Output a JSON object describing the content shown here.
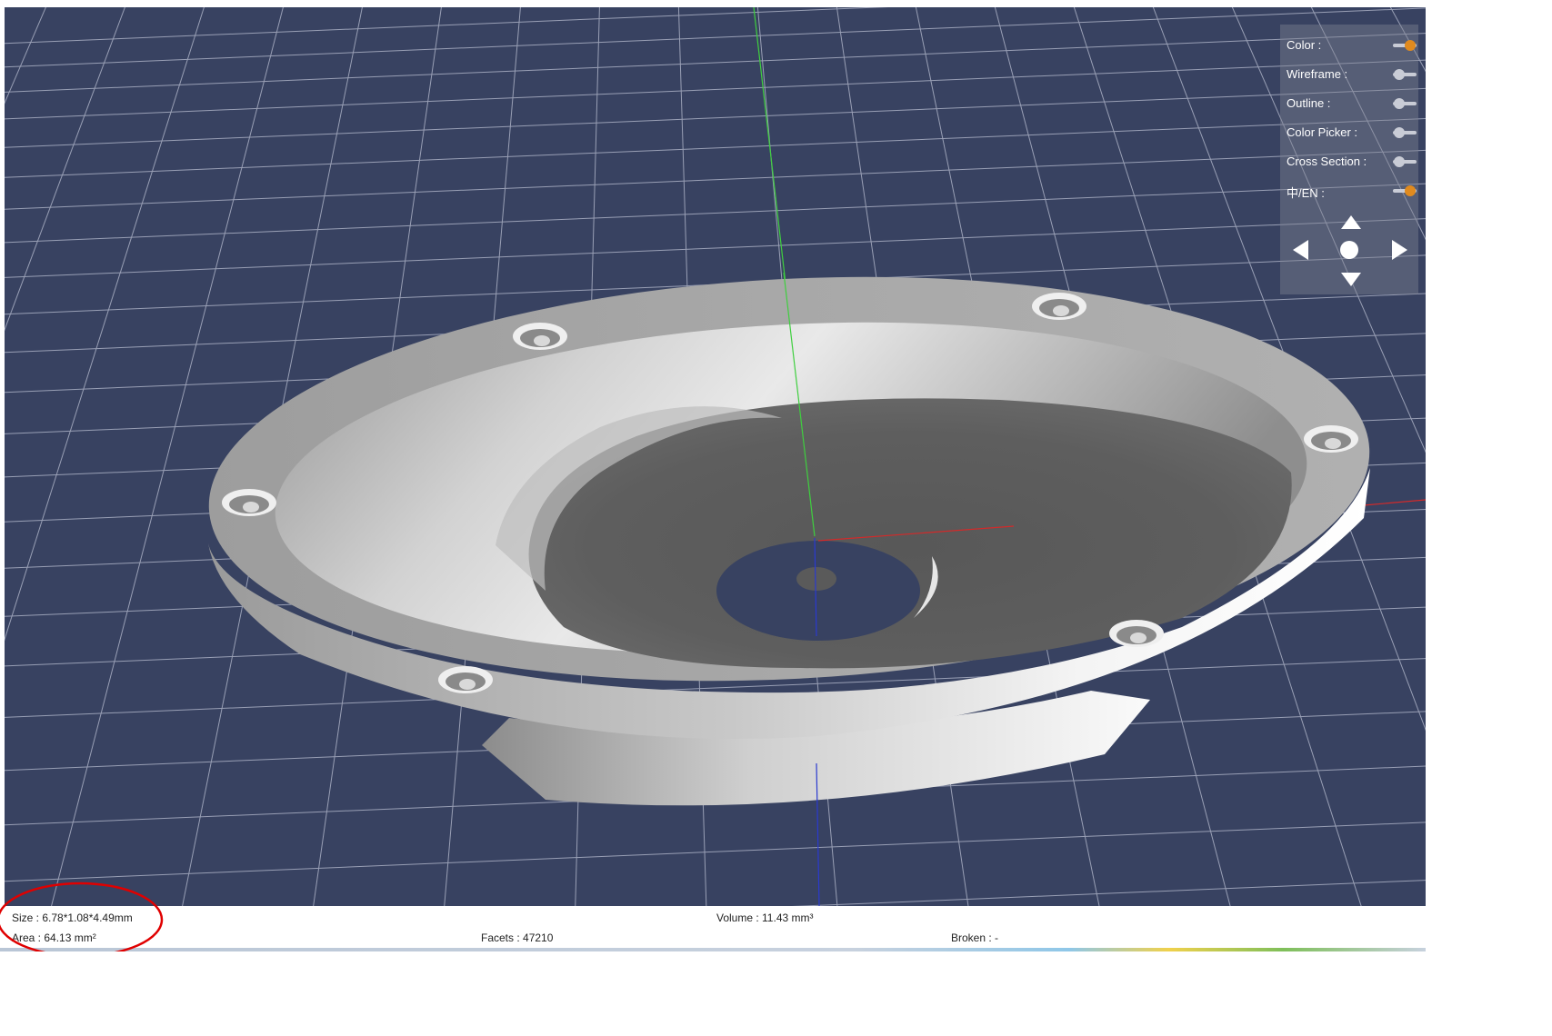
{
  "panel": {
    "toggles": [
      {
        "label": "Color :",
        "on": true
      },
      {
        "label": "Wireframe :",
        "on": false
      },
      {
        "label": "Outline :",
        "on": false
      },
      {
        "label": "Color Picker :",
        "on": false
      },
      {
        "label": "Cross Section :",
        "on": false
      },
      {
        "label": "中/EN :",
        "on": true
      }
    ],
    "nav_icons": [
      "arrow-up",
      "arrow-left",
      "circle-reset",
      "arrow-right",
      "arrow-down"
    ]
  },
  "status": {
    "size": "Size : 6.78*1.08*4.49mm",
    "volume": "Volume : 11.43 mm³",
    "area": "Area : 64.13 mm²",
    "facets": "Facets : 47210",
    "broken": "Broken : -"
  },
  "colors": {
    "background": "#384261",
    "grid": "#aab0c4",
    "model": "#a6a6a6",
    "accent": "#e08a1e",
    "annotation": "#e00000"
  }
}
